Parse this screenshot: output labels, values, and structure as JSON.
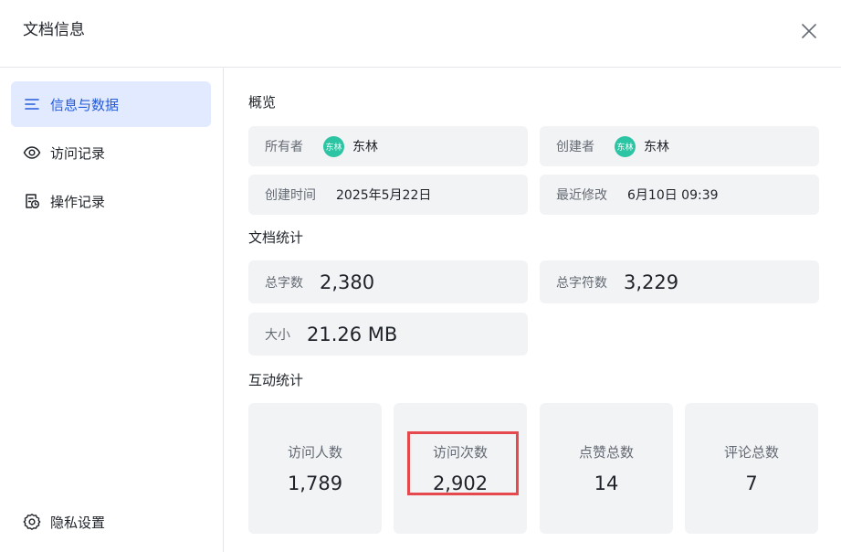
{
  "dialog": {
    "title": "文档信息"
  },
  "sidebar": {
    "items": [
      {
        "label": "信息与数据",
        "icon": "list-icon",
        "active": true
      },
      {
        "label": "访问记录",
        "icon": "eye-icon",
        "active": false
      },
      {
        "label": "操作记录",
        "icon": "document-history-icon",
        "active": false
      }
    ],
    "footer_label": "隐私设置"
  },
  "overview": {
    "title": "概览",
    "owner_label": "所有者",
    "owner_name": "东林",
    "owner_avatar": "东林",
    "creator_label": "创建者",
    "creator_name": "东林",
    "creator_avatar": "东林",
    "created_label": "创建时间",
    "created_value": "2025年5月22日",
    "modified_label": "最近修改",
    "modified_value": "6月10日 09:39"
  },
  "doc_stats": {
    "title": "文档统计",
    "words_label": "总字数",
    "words_value": "2,380",
    "chars_label": "总字符数",
    "chars_value": "3,229",
    "size_label": "大小",
    "size_value": "21.26 MB"
  },
  "interaction": {
    "title": "互动统计",
    "items": [
      {
        "label": "访问人数",
        "value": "1,789"
      },
      {
        "label": "访问次数",
        "value": "2,902"
      },
      {
        "label": "点赞总数",
        "value": "14"
      },
      {
        "label": "评论总数",
        "value": "7"
      }
    ]
  },
  "colors": {
    "accent": "#245bdb",
    "active_bg": "#e1eaff",
    "avatar": "#2bc5a3",
    "highlight": "#e5484d"
  }
}
